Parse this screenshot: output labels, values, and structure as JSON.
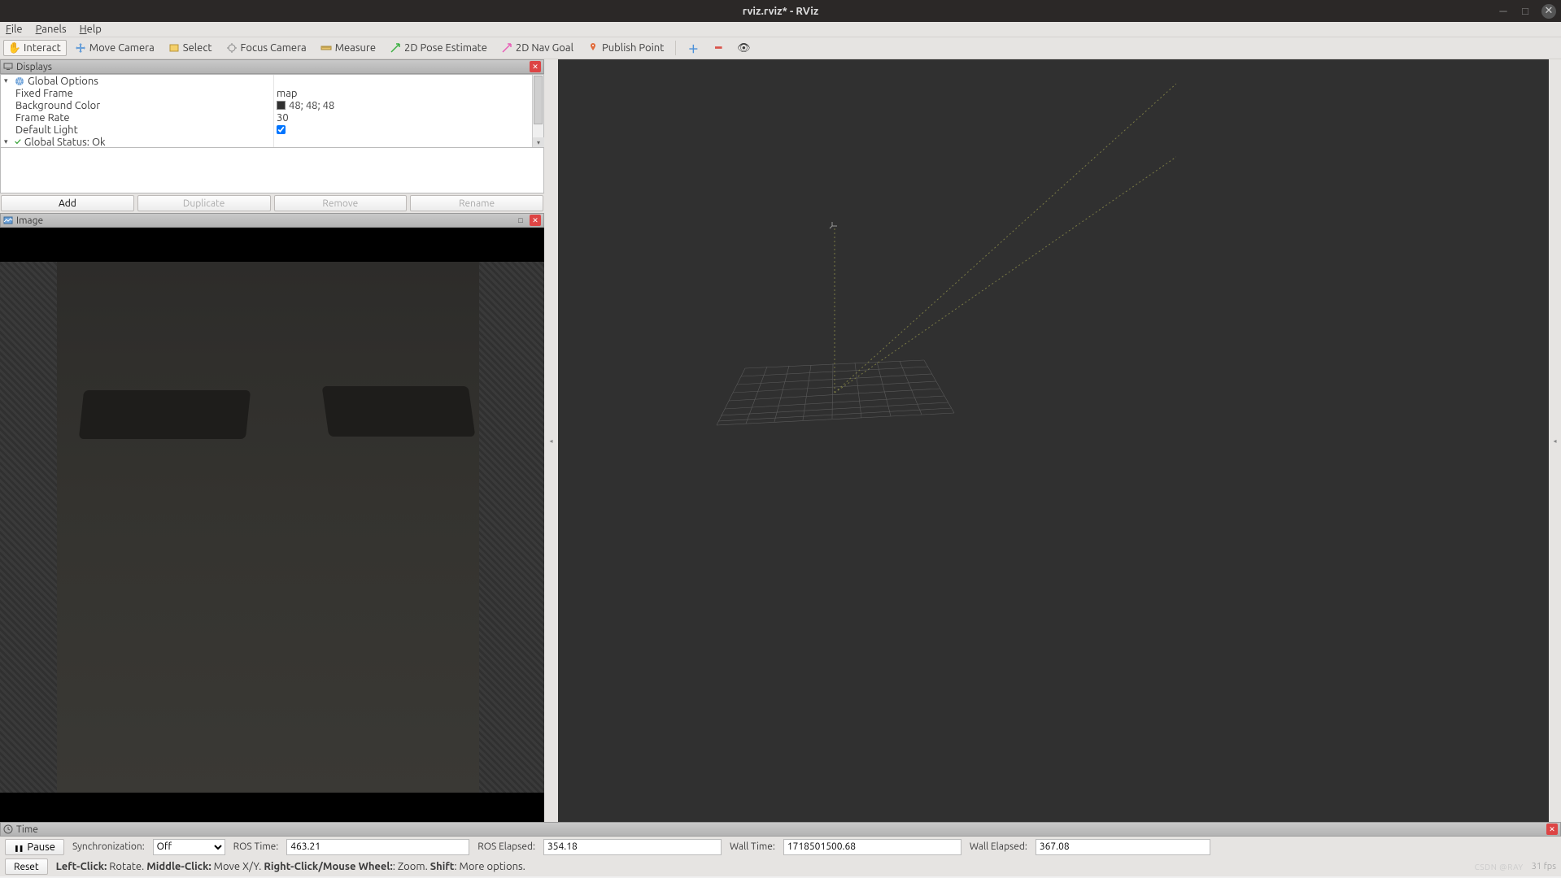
{
  "window": {
    "title": "rviz.rviz* - RViz"
  },
  "menu": {
    "file": "File",
    "panels": "Panels",
    "help": "Help"
  },
  "toolbar": {
    "interact": "Interact",
    "move_camera": "Move Camera",
    "select": "Select",
    "focus_camera": "Focus Camera",
    "measure": "Measure",
    "pose_estimate": "2D Pose Estimate",
    "nav_goal": "2D Nav Goal",
    "publish_point": "Publish Point"
  },
  "displays": {
    "title": "Displays",
    "tree": {
      "global_options": {
        "label": "Global Options",
        "fixed_frame": {
          "label": "Fixed Frame",
          "value": "map"
        },
        "background_color": {
          "label": "Background Color",
          "value": "48; 48; 48"
        },
        "frame_rate": {
          "label": "Frame Rate",
          "value": "30"
        },
        "default_light": {
          "label": "Default Light",
          "checked": true
        }
      },
      "global_status": {
        "label": "Global Status: Ok"
      }
    },
    "buttons": {
      "add": "Add",
      "duplicate": "Duplicate",
      "remove": "Remove",
      "rename": "Rename"
    }
  },
  "image_panel": {
    "title": "Image"
  },
  "time_panel": {
    "title": "Time",
    "pause": "Pause",
    "sync_label": "Synchronization:",
    "sync_value": "Off",
    "ros_time_label": "ROS Time:",
    "ros_time": "463.21",
    "ros_elapsed_label": "ROS Elapsed:",
    "ros_elapsed": "354.18",
    "wall_time_label": "Wall Time:",
    "wall_time": "1718501500.68",
    "wall_elapsed_label": "Wall Elapsed:",
    "wall_elapsed": "367.08"
  },
  "status": {
    "reset": "Reset",
    "hints_html": "Left-Click: Rotate. Middle-Click: Move X/Y. Right-Click/Mouse Wheel:: Zoom. Shift: More options.",
    "h_left": "Left-Click:",
    "h_left_v": " Rotate. ",
    "h_mid": "Middle-Click:",
    "h_mid_v": " Move X/Y. ",
    "h_right": "Right-Click/Mouse Wheel:",
    "h_right_v": ": Zoom. ",
    "h_shift": "Shift",
    "h_shift_v": ": More options.",
    "fps": "31 fps",
    "watermark": "CSDN @RAY"
  }
}
